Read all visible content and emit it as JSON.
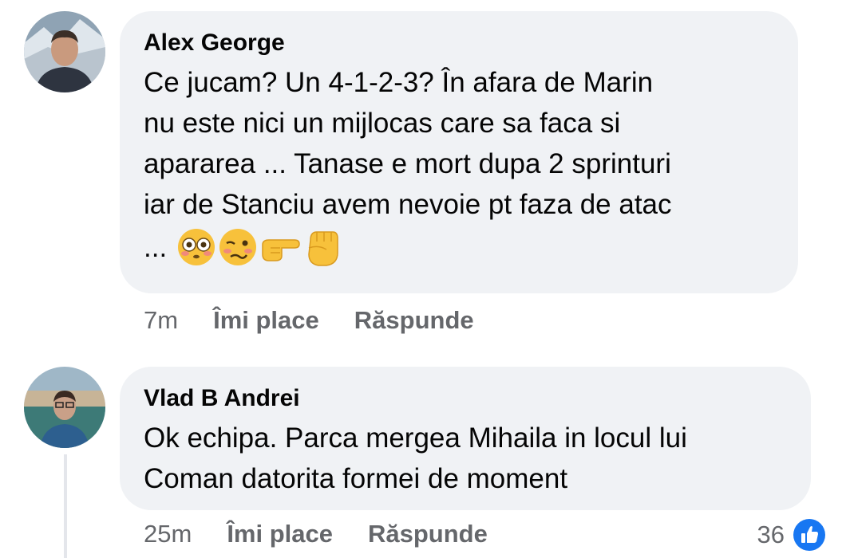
{
  "comments": [
    {
      "author": "Alex George",
      "lines": [
        "Ce jucam? Un 4-1-2-3?  În afara de Marin",
        "nu este nici un mijlocas care sa faca si",
        "apararea ... Tanase e mort dupa 2 sprinturi",
        "iar de Stanciu avem nevoie pt faza de atac"
      ],
      "trailing_text": "...",
      "emojis": [
        "flushed-face-emoji",
        "woozy-face-emoji",
        "pointing-right-emoji",
        "raised-fist-emoji"
      ],
      "time": "7m",
      "like_label": "Îmi place",
      "reply_label": "Răspunde"
    },
    {
      "author": "Vlad B Andrei",
      "lines": [
        "Ok echipa. Parca mergea Mihaila in locul lui",
        "Coman datorita formei de moment"
      ],
      "time": "25m",
      "like_label": "Îmi place",
      "reply_label": "Răspunde",
      "reaction_count": "36",
      "reaction_icon": "thumbs-up-icon"
    }
  ],
  "colors": {
    "bubble": "#f0f2f5",
    "secondary_text": "#65676b",
    "like_blue": "#1877f2"
  }
}
